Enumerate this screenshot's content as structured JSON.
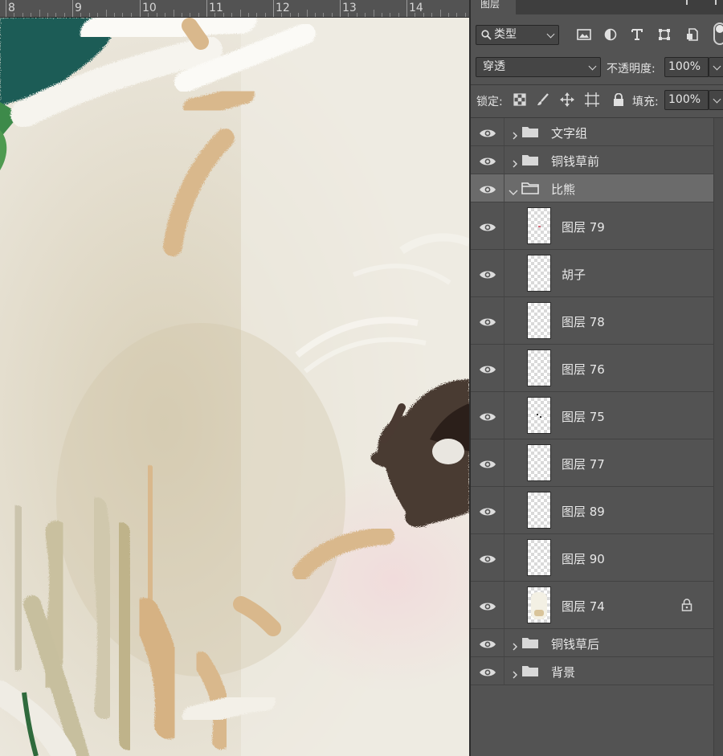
{
  "ruler": {
    "ticks": [
      "8",
      "9",
      "10",
      "11",
      "12",
      "13",
      "14"
    ]
  },
  "panel": {
    "tab_label": "图层",
    "filter": {
      "label": "类型",
      "icons": [
        "image-filter-icon",
        "adjustment-filter-icon",
        "type-filter-icon",
        "shape-filter-icon",
        "smart-object-filter-icon"
      ]
    },
    "blend_mode": "穿透",
    "opacity_label": "不透明度:",
    "opacity_value": "100%",
    "lock_label": "锁定:",
    "fill_label": "填充:",
    "fill_value": "100%"
  },
  "layers": [
    {
      "type": "group",
      "name": "文字组",
      "expanded": false,
      "selected": false
    },
    {
      "type": "group",
      "name": "铜钱草前",
      "expanded": false,
      "selected": false
    },
    {
      "type": "group",
      "name": "比熊",
      "expanded": true,
      "selected": true
    },
    {
      "type": "layer",
      "name": "图层 79",
      "thumb": "pink-dot"
    },
    {
      "type": "layer",
      "name": "胡子",
      "thumb": "empty"
    },
    {
      "type": "layer",
      "name": "图层 78",
      "thumb": "empty"
    },
    {
      "type": "layer",
      "name": "图层 76",
      "thumb": "empty"
    },
    {
      "type": "layer",
      "name": "图层 75",
      "thumb": "dark-dots"
    },
    {
      "type": "layer",
      "name": "图层 77",
      "thumb": "empty"
    },
    {
      "type": "layer",
      "name": "图层 89",
      "thumb": "empty"
    },
    {
      "type": "layer",
      "name": "图层 90",
      "thumb": "empty"
    },
    {
      "type": "layer",
      "name": "图层 74",
      "thumb": "dog",
      "locked": true
    },
    {
      "type": "group",
      "name": "铜钱草后",
      "expanded": false,
      "selected": false
    },
    {
      "type": "group",
      "name": "背景",
      "expanded": false,
      "selected": false
    }
  ],
  "colors": {
    "panel_bg": "#535353",
    "selected_row": "#6b6b6b",
    "canvas_cream": "#ebe7dc",
    "brush_tan": "#d9b88c",
    "teal": "#1f5b57"
  }
}
